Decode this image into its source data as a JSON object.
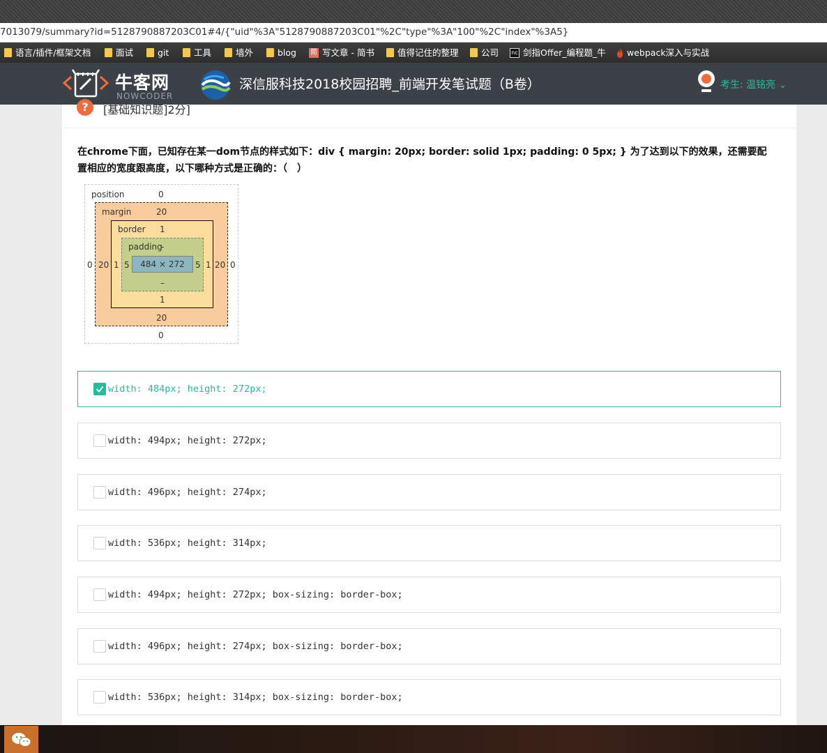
{
  "browser": {
    "url": "7013079/summary?id=5128790887203C01#4/{\"uid\"%3A\"5128790887203C01\"%2C\"type\"%3A\"100\"%2C\"index\"%3A5}",
    "bookmarks": [
      {
        "label": "语言/插件/框架文档",
        "icon": "folder-icon"
      },
      {
        "label": "面试",
        "icon": "folder-icon"
      },
      {
        "label": "git",
        "icon": "folder-icon"
      },
      {
        "label": "工具",
        "icon": "folder-icon"
      },
      {
        "label": "墙外",
        "icon": "folder-icon"
      },
      {
        "label": "blog",
        "icon": "folder-icon"
      },
      {
        "label": "写文章 - 简书",
        "icon": "jianshu-icon"
      },
      {
        "label": "值得记住的整理",
        "icon": "folder-icon"
      },
      {
        "label": "公司",
        "icon": "folder-icon"
      },
      {
        "label": "剑指Offer_编程题_牛",
        "icon": "nowcoder-icon"
      },
      {
        "label": "webpack深入与实战",
        "icon": "flame-icon"
      }
    ]
  },
  "header": {
    "logo_text": "牛客网",
    "logo_sub": "NOWCODER",
    "exam_title": "深信服科技2018校园招聘_前端开发笔试题（B卷）",
    "user_label": "考生: 温铭亮 ⌄",
    "accent_color": "#25bb9b",
    "bg_color": "#3c4148"
  },
  "question": {
    "type_label": "[基础知识题]2分]",
    "text": "在chrome下面，已知存在某一dom节点的样式如下：div { margin: 20px; border: solid 1px; padding: 0 5px; } 为了达到以下的效果，还需要配置相应的宽度跟高度，以下哪种方式是正确的：（　）",
    "diagram": {
      "position_label": "position",
      "position_top": "0",
      "position_bottom": "0",
      "position_left": "0",
      "position_right": "0",
      "margin_label": "margin",
      "margin_top": "20",
      "margin_bottom": "20",
      "margin_left": "20",
      "margin_right": "20",
      "border_label": "border",
      "border_top": "1",
      "border_bottom": "1",
      "border_left": "1",
      "border_right": "1",
      "padding_label": "padding",
      "padding_top": "-",
      "padding_bottom": "–",
      "padding_left": "5",
      "padding_right": "5",
      "content_size": "484 × 272"
    }
  },
  "options": [
    {
      "text": "width: 484px; height: 272px;",
      "checked": true
    },
    {
      "text": "width: 494px; height: 272px;",
      "checked": false
    },
    {
      "text": "width: 496px; height: 274px;",
      "checked": false
    },
    {
      "text": "width: 536px; height: 314px;",
      "checked": false
    },
    {
      "text": "width: 494px; height: 272px; box-sizing: border-box;",
      "checked": false
    },
    {
      "text": "width: 496px; height: 274px; box-sizing: border-box;",
      "checked": false
    },
    {
      "text": "width: 536px; height: 314px; box-sizing: border-box;",
      "checked": false
    }
  ],
  "taskbar": {
    "apps": [
      {
        "icon": "wechat-icon"
      }
    ]
  }
}
